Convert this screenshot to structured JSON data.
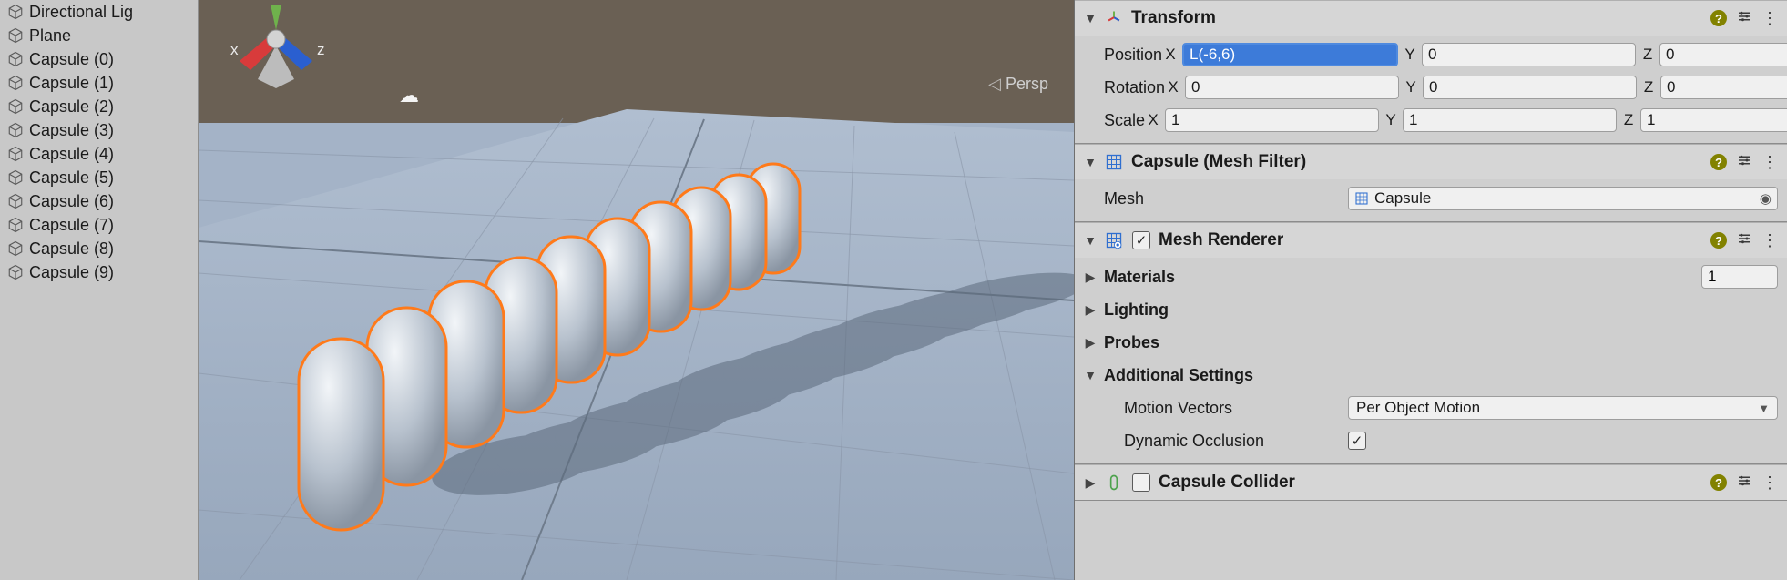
{
  "hierarchy": {
    "items": [
      {
        "label": "Directional Lig",
        "icon": "cube"
      },
      {
        "label": "Plane",
        "icon": "cube"
      },
      {
        "label": "Capsule (0)",
        "icon": "cube"
      },
      {
        "label": "Capsule (1)",
        "icon": "cube"
      },
      {
        "label": "Capsule (2)",
        "icon": "cube"
      },
      {
        "label": "Capsule (3)",
        "icon": "cube"
      },
      {
        "label": "Capsule (4)",
        "icon": "cube"
      },
      {
        "label": "Capsule (5)",
        "icon": "cube"
      },
      {
        "label": "Capsule (6)",
        "icon": "cube"
      },
      {
        "label": "Capsule (7)",
        "icon": "cube"
      },
      {
        "label": "Capsule (8)",
        "icon": "cube"
      },
      {
        "label": "Capsule (9)",
        "icon": "cube"
      }
    ]
  },
  "scene": {
    "camera_mode": "Persp",
    "gizmo": {
      "x_label": "x",
      "z_label": "z"
    },
    "cloud_icon": "☁"
  },
  "inspector": {
    "transform": {
      "title": "Transform",
      "position": {
        "label": "Position",
        "x": "L(-6,6)",
        "x_selected": true,
        "y": "0",
        "z": "0"
      },
      "rotation": {
        "label": "Rotation",
        "x": "0",
        "y": "0",
        "z": "0"
      },
      "scale": {
        "label": "Scale",
        "x": "1",
        "y": "1",
        "z": "1"
      },
      "axis_x": "X",
      "axis_y": "Y",
      "axis_z": "Z"
    },
    "mesh_filter": {
      "title": "Capsule (Mesh Filter)",
      "mesh_label": "Mesh",
      "mesh_value": "Capsule"
    },
    "mesh_renderer": {
      "title": "Mesh Renderer",
      "enabled": true,
      "materials": {
        "label": "Materials",
        "count": "1"
      },
      "lighting": {
        "label": "Lighting"
      },
      "probes": {
        "label": "Probes"
      },
      "additional": {
        "label": "Additional Settings",
        "motion_vectors": {
          "label": "Motion Vectors",
          "value": "Per Object Motion"
        },
        "dynamic_occlusion": {
          "label": "Dynamic Occlusion",
          "checked": true
        }
      }
    },
    "capsule_collider": {
      "title": "Capsule Collider",
      "enabled": false
    }
  }
}
